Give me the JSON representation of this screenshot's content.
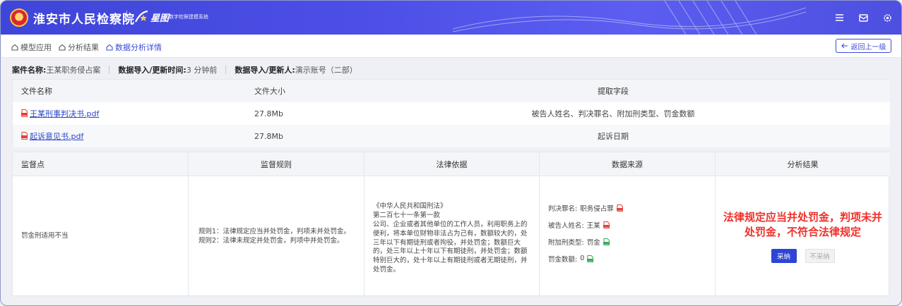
{
  "header": {
    "brand": "淮安市人民检察院",
    "product_name": "星图",
    "product_sub": "数字检察建模系统",
    "icons": [
      "menu-icon",
      "mail-icon",
      "settings-icon"
    ]
  },
  "breadcrumb": [
    {
      "label": "模型应用",
      "icon": "home-icon"
    },
    {
      "label": "分析结果",
      "icon": "home-icon"
    },
    {
      "label": "数据分析详情",
      "icon": "home-icon"
    }
  ],
  "back_button": "返回上一级",
  "case_info": {
    "name_label": "案件名称:",
    "name_value": "王某职务侵占案",
    "time_label": "数据导入/更新时间:",
    "time_value": "3 分钟前",
    "user_label": "数据导入/更新人:",
    "user_value": "演示账号（二部）"
  },
  "file_table": {
    "headers": [
      "文件名称",
      "文件大小",
      "提取字段"
    ],
    "rows": [
      {
        "name": "王某刑事判决书.pdf",
        "size": "27.8Mb",
        "fields": "被告人姓名、判决罪名、附加刑类型、罚金数额"
      },
      {
        "name": "起诉意见书.pdf",
        "size": "27.8Mb",
        "fields": "起诉日期"
      }
    ]
  },
  "analysis_table": {
    "headers": [
      "监督点",
      "监督规则",
      "法律依据",
      "数据来源",
      "分析结果"
    ],
    "row": {
      "point": "罚金刑适用不当",
      "rule1": "规则1：法律规定应当并处罚金，判项未并处罚金。",
      "rule2": "规则2：法律未规定并处罚金，判项中并处罚金。",
      "law_title": "《中华人民共和国刑法》",
      "law_article": "第二百七十一条第一款",
      "law_text": "公司、企业或者其他单位的工作人员，利用职务上的便利，将本单位财物非法占为己有，数额较大的，处三年以下有期徒刑或者拘役，并处罚金；数额巨大的，处三年以上十年以下有期徒刑，并处罚金；数额特别巨大的，处十年以上有期徒刑或者无期徒刑，并处罚金。",
      "sources": [
        {
          "label": "判决罪名:",
          "value": "职务侵占罪",
          "icon_color": "#e0413a"
        },
        {
          "label": "被告人姓名:",
          "value": "王某",
          "icon_color": "#e0413a"
        },
        {
          "label": "附加刑类型:",
          "value": "罚金",
          "icon_color": "#3aa65a"
        },
        {
          "label": "罚金数额:",
          "value": "0",
          "icon_color": "#3aa65a"
        }
      ],
      "result": "法律规定应当并处罚金，判项未并处罚金，不符合法律规定",
      "adopt_label": "采纳",
      "reject_label": "不采纳"
    }
  },
  "colors": {
    "accent": "#3a4bd8",
    "result_red": "#f0302a",
    "header": "#4c4fe6"
  }
}
